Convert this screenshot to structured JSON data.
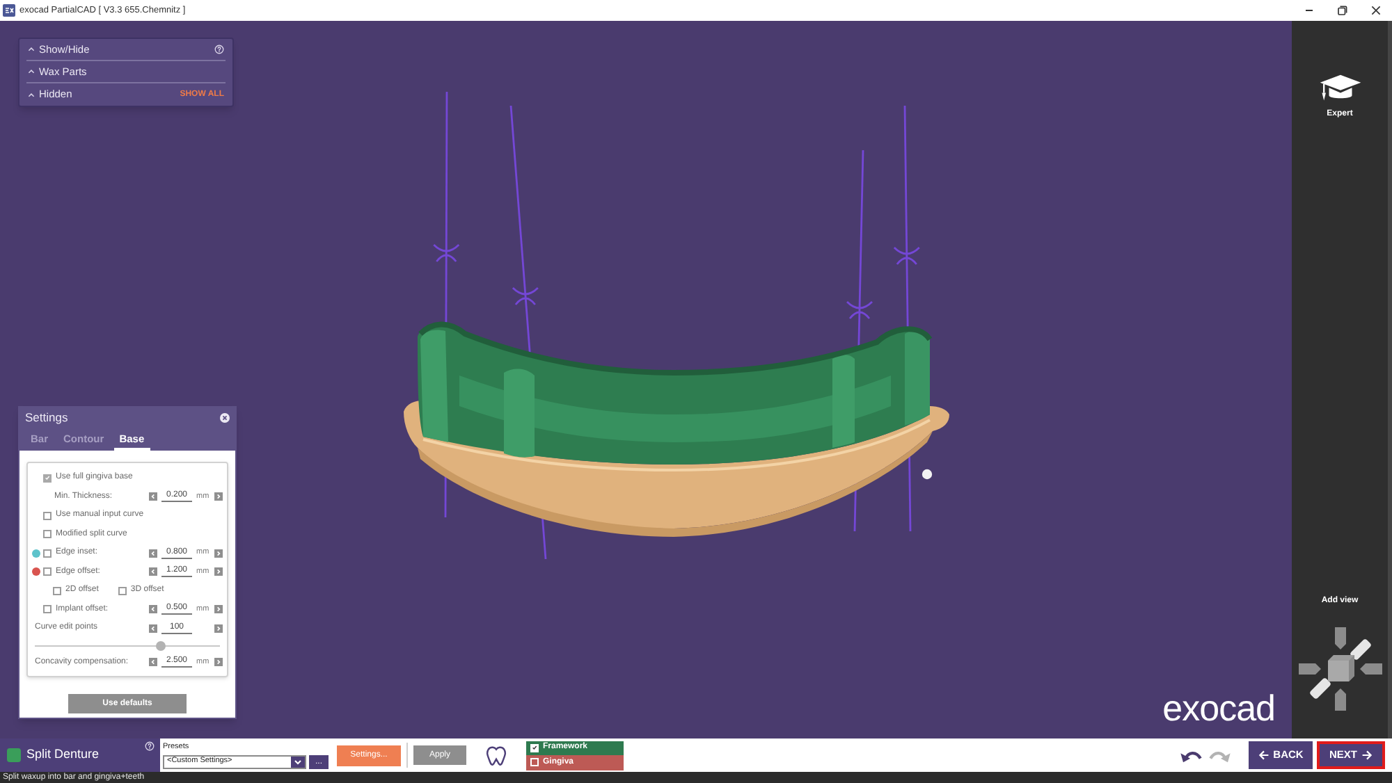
{
  "window": {
    "title": "exocad PartialCAD [ V3.3 655.Chemnitz ]"
  },
  "visibility_panel": {
    "rows": [
      {
        "kind": "help",
        "label": "Show/Hide"
      },
      {
        "kind": "plain",
        "label": "Wax Parts"
      },
      {
        "kind": "action",
        "label": "Hidden",
        "action": "SHOW ALL"
      }
    ]
  },
  "settings": {
    "title": "Settings",
    "tabs": [
      {
        "label": "Bar",
        "selected": false
      },
      {
        "label": "Contour",
        "selected": false
      },
      {
        "label": "Base",
        "selected": true
      }
    ],
    "rows": [
      {
        "kind": "checkbox",
        "label": "Use full gingiva base",
        "checked": true,
        "children": [
          {
            "kind": "spin",
            "label": "Min. Thickness:",
            "value": "0.200",
            "unit": "mm"
          }
        ]
      },
      {
        "kind": "checkbox",
        "label": "Use manual input curve",
        "checked": false
      },
      {
        "kind": "checkbox",
        "label": "Modified split curve",
        "checked": false
      },
      {
        "kind": "check_spin",
        "label": "Edge inset:",
        "checked": false,
        "color": "#5ec3cb",
        "value": "0.800",
        "unit": "mm"
      },
      {
        "kind": "check_spin",
        "label": "Edge offset:",
        "checked": false,
        "color": "#d9544f",
        "value": "1.200",
        "unit": "mm",
        "children": [
          {
            "kind": "checkbox",
            "label": "2D offset",
            "checked": false
          },
          {
            "kind": "checkbox",
            "label": "3D offset",
            "checked": false
          }
        ]
      },
      {
        "kind": "check_spin",
        "label": "Implant offset:",
        "checked": false,
        "value": "0.500",
        "unit": "mm"
      },
      {
        "kind": "spin",
        "label": "Curve edit points",
        "value": "100"
      },
      {
        "kind": "slider",
        "level": 0.68
      },
      {
        "kind": "spin",
        "label": "Concavity compensation:",
        "value": "2.500",
        "unit": "mm"
      }
    ],
    "defaults_button": {
      "label": "Use defaults",
      "disabled": true
    }
  },
  "viewport": {
    "logo": "exocad"
  },
  "sidebar": {
    "expert": "Expert",
    "add_view": "Add view"
  },
  "bottom_bar": {
    "step": "Split Denture",
    "presets": {
      "label": "Presets",
      "value": "<Custom Settings>",
      "more": "..."
    },
    "settings_button": "Settings...",
    "apply": {
      "label": "Apply",
      "disabled": true
    },
    "layers": [
      {
        "label": "Framework",
        "checked": true,
        "color": "#2e7a4f"
      },
      {
        "label": "Gingiva",
        "checked": false,
        "color": "#bd5a55"
      }
    ],
    "history": [
      {
        "kind": "undo",
        "disabled": false
      },
      {
        "kind": "redo",
        "disabled": true
      }
    ],
    "nav": [
      {
        "kind": "back",
        "label": "BACK",
        "highlighted": false
      },
      {
        "kind": "next",
        "label": "NEXT",
        "highlighted": true
      }
    ]
  },
  "status_bar": {
    "text": "Split waxup into bar and gingiva+teeth"
  }
}
